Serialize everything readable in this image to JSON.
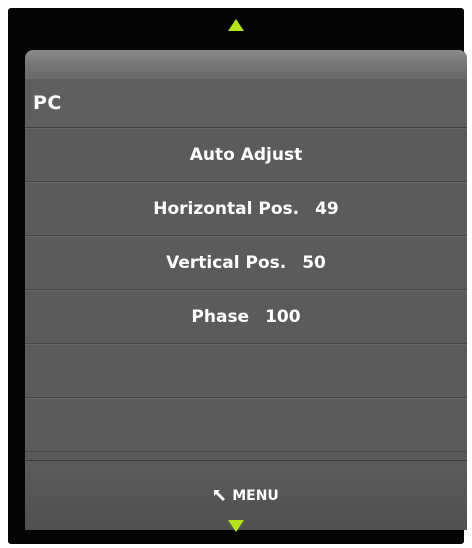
{
  "menu": {
    "title": "PC",
    "items": [
      {
        "label": "Auto Adjust",
        "value": ""
      },
      {
        "label": "Horizontal Pos.",
        "value": "49"
      },
      {
        "label": "Vertical Pos.",
        "value": "50"
      },
      {
        "label": "Phase",
        "value": "100"
      },
      {
        "label": "",
        "value": ""
      },
      {
        "label": "",
        "value": ""
      }
    ],
    "footer_label": "MENU"
  },
  "icons": {
    "up": "triangle-up-icon",
    "down": "triangle-down-icon",
    "back": "return-arrow-icon"
  },
  "colors": {
    "arrow": "#b6e21b",
    "panel": "#5a5a5a",
    "text": "#ffffff",
    "background": "#050505"
  }
}
